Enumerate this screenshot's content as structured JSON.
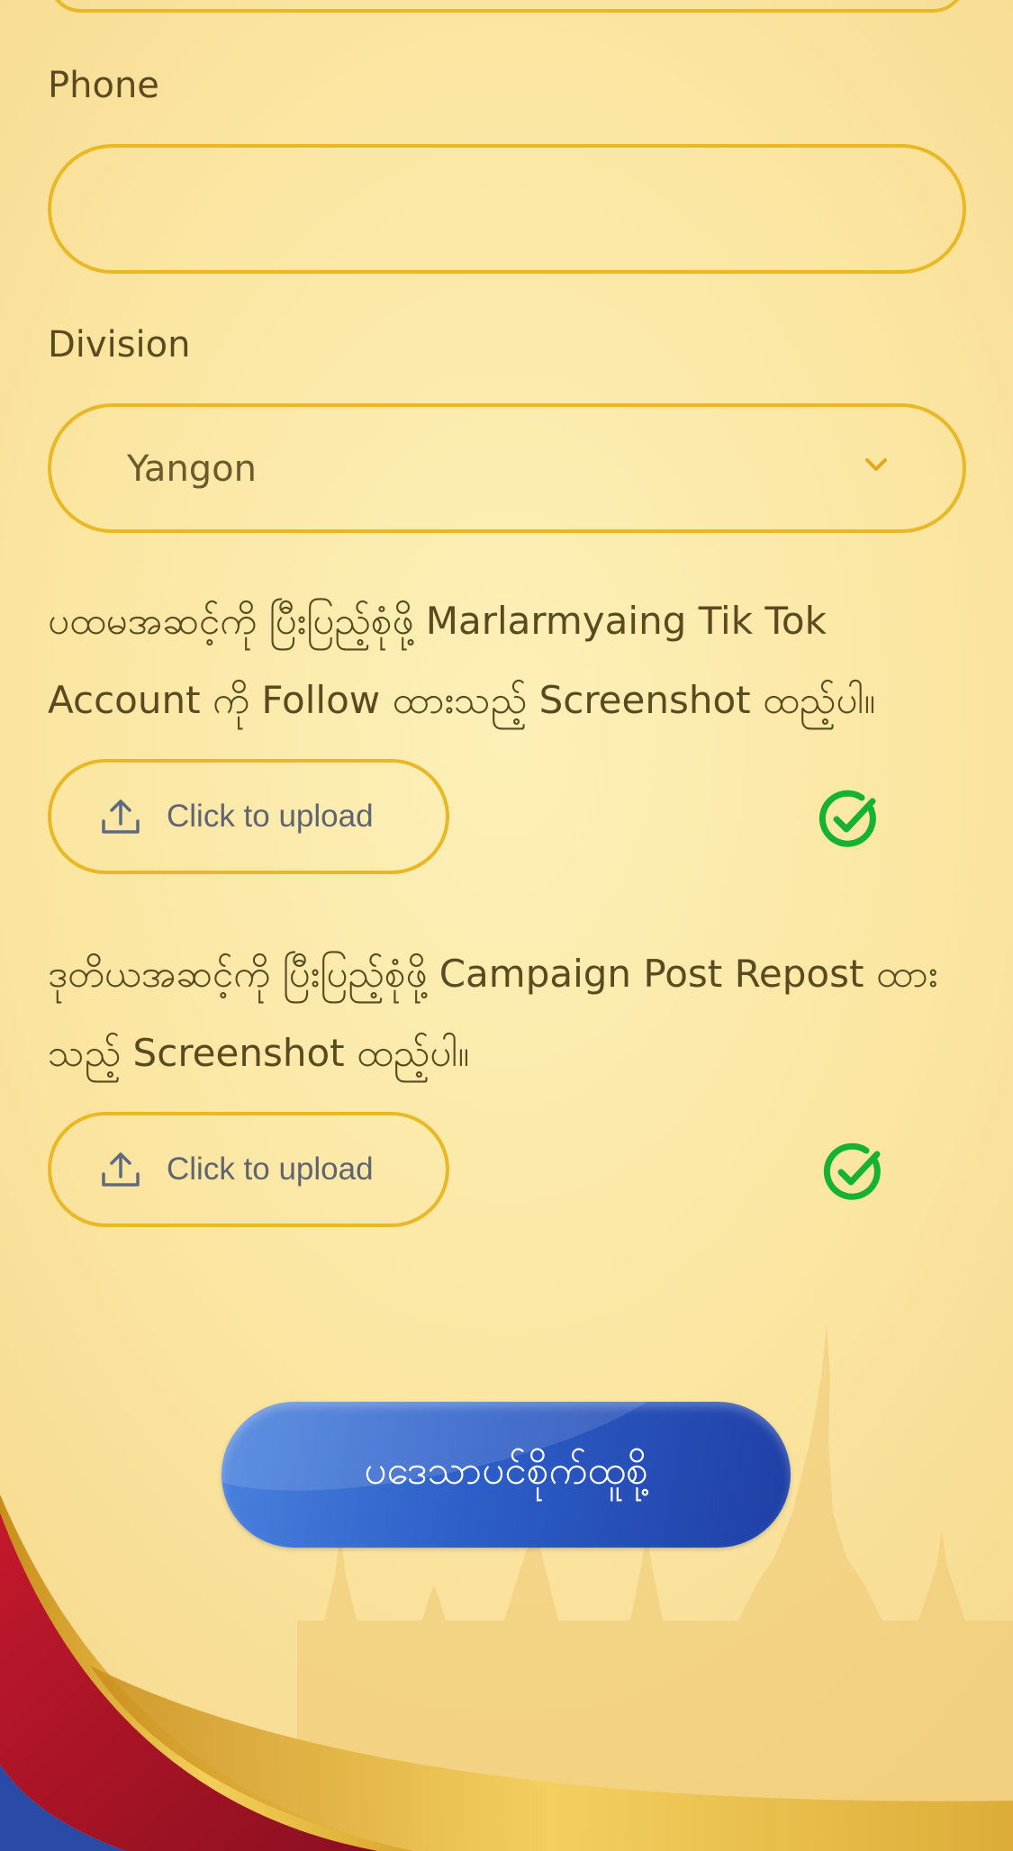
{
  "form": {
    "phone": {
      "label": "Phone",
      "value": "",
      "placeholder": ""
    },
    "division": {
      "label": "Division",
      "selected": "Yangon"
    },
    "steps": [
      {
        "instruction": "ပထမအဆင့်ကို ပြီးပြည့်စုံဖို့ Marlarmyaing Tik Tok Account ကို Follow ထားသည့် Screenshot ထည့်ပါ။",
        "upload_label": "Click to upload",
        "uploaded": true
      },
      {
        "instruction": "ဒုတိယအဆင့်ကို ပြီးပြည့်စုံဖို့ Campaign Post Repost ထားသည့် Screenshot ထည့်ပါ။",
        "upload_label": "Click to upload",
        "uploaded": true
      }
    ],
    "submit_label": "ပဒေသာပင်စိုက်ထူစို့"
  },
  "colors": {
    "background": "#fbe6a2",
    "field_border": "#e9b824",
    "label_text": "#5b4a1f",
    "check_green": "#16b232",
    "button_blue": "#2d5ec7",
    "ribbon_red": "#b51a2e",
    "ribbon_blue": "#2a4aa8",
    "ribbon_gold": "#e0ac2a"
  },
  "icons": {
    "dropdown": "chevron-down-icon",
    "upload": "upload-icon",
    "status": "check-circle-icon"
  }
}
